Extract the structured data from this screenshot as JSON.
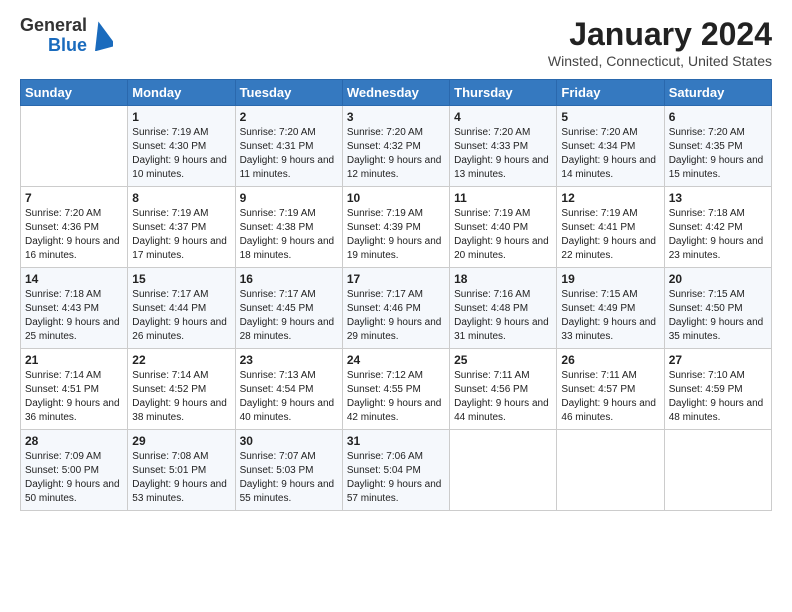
{
  "header": {
    "logo": {
      "line1": "General",
      "line2": "Blue"
    },
    "title": "January 2024",
    "location": "Winsted, Connecticut, United States"
  },
  "calendar": {
    "days_of_week": [
      "Sunday",
      "Monday",
      "Tuesday",
      "Wednesday",
      "Thursday",
      "Friday",
      "Saturday"
    ],
    "weeks": [
      [
        {
          "day": "",
          "sunrise": "",
          "sunset": "",
          "daylight": ""
        },
        {
          "day": "1",
          "sunrise": "7:19 AM",
          "sunset": "4:30 PM",
          "daylight": "9 hours and 10 minutes."
        },
        {
          "day": "2",
          "sunrise": "7:20 AM",
          "sunset": "4:31 PM",
          "daylight": "9 hours and 11 minutes."
        },
        {
          "day": "3",
          "sunrise": "7:20 AM",
          "sunset": "4:32 PM",
          "daylight": "9 hours and 12 minutes."
        },
        {
          "day": "4",
          "sunrise": "7:20 AM",
          "sunset": "4:33 PM",
          "daylight": "9 hours and 13 minutes."
        },
        {
          "day": "5",
          "sunrise": "7:20 AM",
          "sunset": "4:34 PM",
          "daylight": "9 hours and 14 minutes."
        },
        {
          "day": "6",
          "sunrise": "7:20 AM",
          "sunset": "4:35 PM",
          "daylight": "9 hours and 15 minutes."
        }
      ],
      [
        {
          "day": "7",
          "sunrise": "7:20 AM",
          "sunset": "4:36 PM",
          "daylight": "9 hours and 16 minutes."
        },
        {
          "day": "8",
          "sunrise": "7:19 AM",
          "sunset": "4:37 PM",
          "daylight": "9 hours and 17 minutes."
        },
        {
          "day": "9",
          "sunrise": "7:19 AM",
          "sunset": "4:38 PM",
          "daylight": "9 hours and 18 minutes."
        },
        {
          "day": "10",
          "sunrise": "7:19 AM",
          "sunset": "4:39 PM",
          "daylight": "9 hours and 19 minutes."
        },
        {
          "day": "11",
          "sunrise": "7:19 AM",
          "sunset": "4:40 PM",
          "daylight": "9 hours and 20 minutes."
        },
        {
          "day": "12",
          "sunrise": "7:19 AM",
          "sunset": "4:41 PM",
          "daylight": "9 hours and 22 minutes."
        },
        {
          "day": "13",
          "sunrise": "7:18 AM",
          "sunset": "4:42 PM",
          "daylight": "9 hours and 23 minutes."
        }
      ],
      [
        {
          "day": "14",
          "sunrise": "7:18 AM",
          "sunset": "4:43 PM",
          "daylight": "9 hours and 25 minutes."
        },
        {
          "day": "15",
          "sunrise": "7:17 AM",
          "sunset": "4:44 PM",
          "daylight": "9 hours and 26 minutes."
        },
        {
          "day": "16",
          "sunrise": "7:17 AM",
          "sunset": "4:45 PM",
          "daylight": "9 hours and 28 minutes."
        },
        {
          "day": "17",
          "sunrise": "7:17 AM",
          "sunset": "4:46 PM",
          "daylight": "9 hours and 29 minutes."
        },
        {
          "day": "18",
          "sunrise": "7:16 AM",
          "sunset": "4:48 PM",
          "daylight": "9 hours and 31 minutes."
        },
        {
          "day": "19",
          "sunrise": "7:15 AM",
          "sunset": "4:49 PM",
          "daylight": "9 hours and 33 minutes."
        },
        {
          "day": "20",
          "sunrise": "7:15 AM",
          "sunset": "4:50 PM",
          "daylight": "9 hours and 35 minutes."
        }
      ],
      [
        {
          "day": "21",
          "sunrise": "7:14 AM",
          "sunset": "4:51 PM",
          "daylight": "9 hours and 36 minutes."
        },
        {
          "day": "22",
          "sunrise": "7:14 AM",
          "sunset": "4:52 PM",
          "daylight": "9 hours and 38 minutes."
        },
        {
          "day": "23",
          "sunrise": "7:13 AM",
          "sunset": "4:54 PM",
          "daylight": "9 hours and 40 minutes."
        },
        {
          "day": "24",
          "sunrise": "7:12 AM",
          "sunset": "4:55 PM",
          "daylight": "9 hours and 42 minutes."
        },
        {
          "day": "25",
          "sunrise": "7:11 AM",
          "sunset": "4:56 PM",
          "daylight": "9 hours and 44 minutes."
        },
        {
          "day": "26",
          "sunrise": "7:11 AM",
          "sunset": "4:57 PM",
          "daylight": "9 hours and 46 minutes."
        },
        {
          "day": "27",
          "sunrise": "7:10 AM",
          "sunset": "4:59 PM",
          "daylight": "9 hours and 48 minutes."
        }
      ],
      [
        {
          "day": "28",
          "sunrise": "7:09 AM",
          "sunset": "5:00 PM",
          "daylight": "9 hours and 50 minutes."
        },
        {
          "day": "29",
          "sunrise": "7:08 AM",
          "sunset": "5:01 PM",
          "daylight": "9 hours and 53 minutes."
        },
        {
          "day": "30",
          "sunrise": "7:07 AM",
          "sunset": "5:03 PM",
          "daylight": "9 hours and 55 minutes."
        },
        {
          "day": "31",
          "sunrise": "7:06 AM",
          "sunset": "5:04 PM",
          "daylight": "9 hours and 57 minutes."
        },
        {
          "day": "",
          "sunrise": "",
          "sunset": "",
          "daylight": ""
        },
        {
          "day": "",
          "sunrise": "",
          "sunset": "",
          "daylight": ""
        },
        {
          "day": "",
          "sunrise": "",
          "sunset": "",
          "daylight": ""
        }
      ]
    ],
    "labels": {
      "sunrise": "Sunrise:",
      "sunset": "Sunset:",
      "daylight": "Daylight:"
    }
  }
}
